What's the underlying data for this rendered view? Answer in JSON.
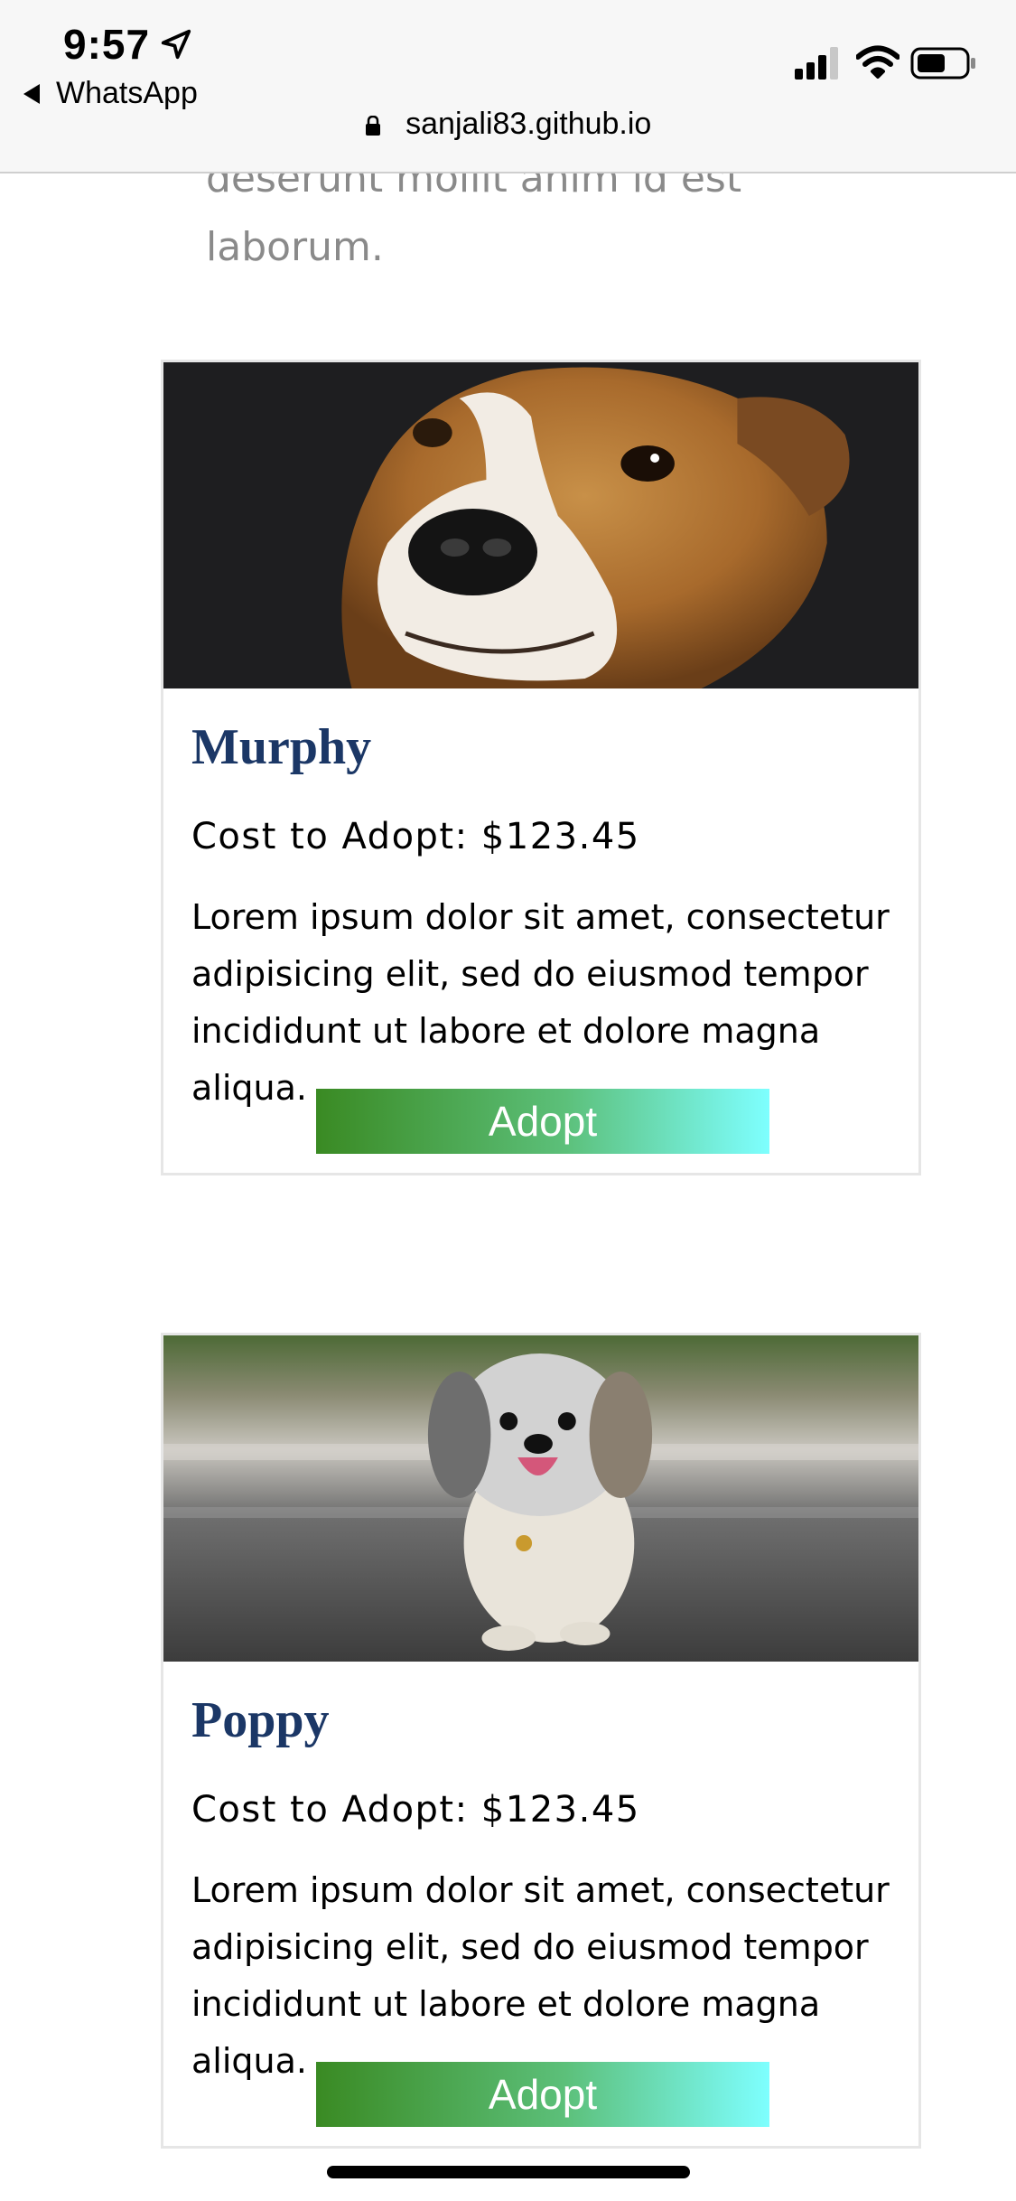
{
  "status_bar": {
    "time": "9:57",
    "back_app": "WhatsApp",
    "icons": [
      "location-arrow-icon",
      "signal-icon",
      "wifi-icon",
      "battery-icon"
    ]
  },
  "browser": {
    "url": "sanjali83.github.io"
  },
  "page": {
    "intro_text": "deserunt mollit anim id est laborum."
  },
  "pets": [
    {
      "name": "Murphy",
      "cost": "Cost to Adopt: $123.45",
      "description": "Lorem ipsum dolor sit amet, consectetur adipisicing elit, sed do eiusmod tempor incididunt ut labore et dolore magna aliqua.",
      "button": "Adopt",
      "photo": "brown-white-dog-closeup"
    },
    {
      "name": "Poppy",
      "cost": "Cost to Adopt: $123.45",
      "description": "Lorem ipsum dolor sit amet, consectetur adipisicing elit, sed do eiusmod tempor incididunt ut labore et dolore magna aliqua.",
      "button": "Adopt",
      "photo": "fluffy-small-dog-on-road"
    }
  ],
  "colors": {
    "title": "#1b3766",
    "button_gradient_start": "#3a8a23",
    "button_gradient_end": "#7effff",
    "intro_text": "#8a8a8a"
  }
}
